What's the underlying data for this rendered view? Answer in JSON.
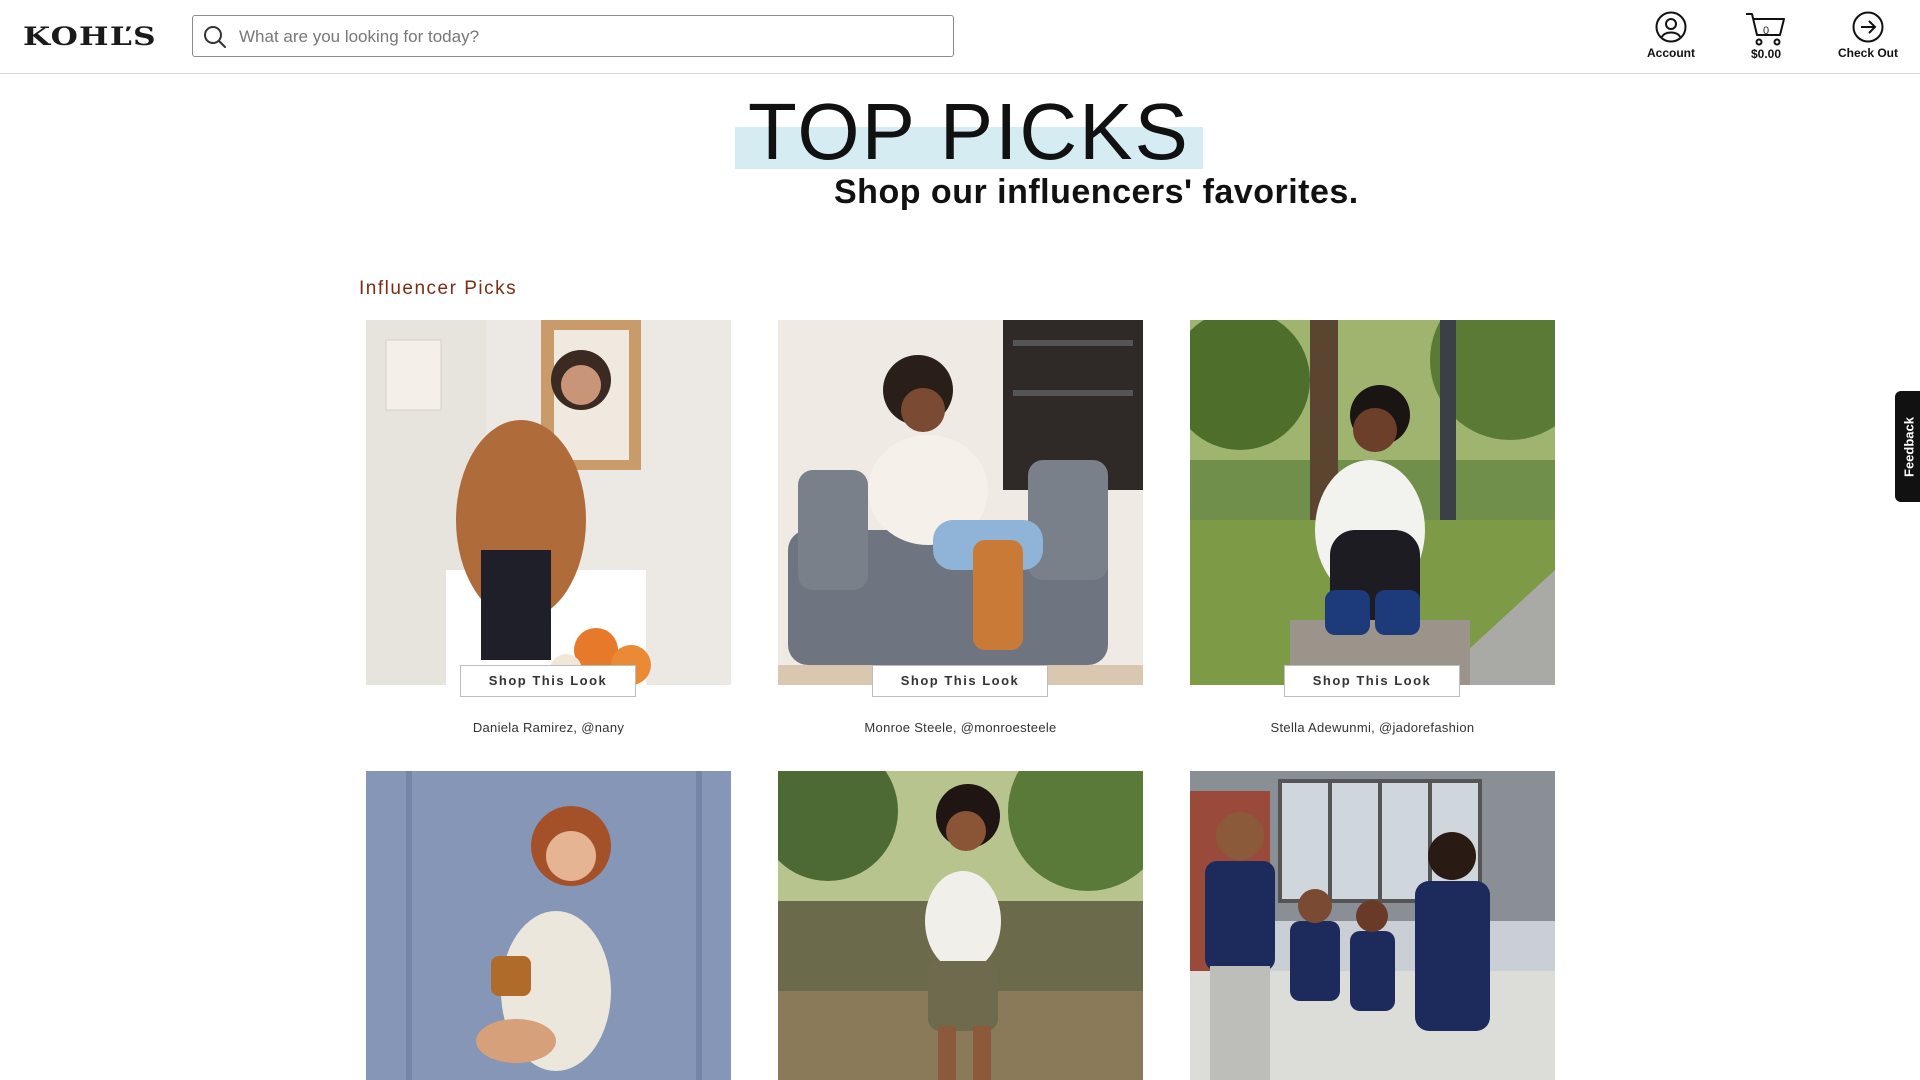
{
  "header": {
    "logo": "KOHĽS",
    "search_placeholder": "What are you looking for today?",
    "account_label": "Account",
    "cart_count": "0",
    "cart_total": "$0.00",
    "checkout_label": "Check Out"
  },
  "hero": {
    "title": "TOP PICKS",
    "subtitle": "Shop our influencers' favorites."
  },
  "section": {
    "title": "Influencer Picks"
  },
  "cards": [
    {
      "shop_label": "Shop This Look",
      "caption": "Daniela Ramirez, @nany"
    },
    {
      "shop_label": "Shop This Look",
      "caption": "Monroe Steele, @monroesteele"
    },
    {
      "shop_label": "Shop This Look",
      "caption": "Stella Adewunmi, @jadorefashion"
    }
  ],
  "feedback": {
    "label": "Feedback"
  },
  "colors": {
    "brand": "#1a1a1a",
    "hero_band": "#d6ecf3",
    "section_title": "#7a2d12"
  }
}
